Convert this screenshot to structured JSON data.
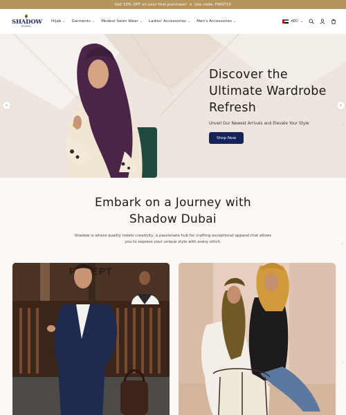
{
  "announcement": {
    "text_before": "Get 10% OFF on your first purchase!",
    "text_after": "Use code: FIRST10"
  },
  "header": {
    "logo": {
      "name": "SHADOW",
      "sub": "DUBAI"
    },
    "nav": [
      {
        "label": "Hijab"
      },
      {
        "label": "Garments"
      },
      {
        "label": "Modest Swim Wear"
      },
      {
        "label": "Ladies' Accessories"
      },
      {
        "label": "Men's Accessories"
      }
    ],
    "currency": "AED",
    "icons": [
      "uae-flag-icon",
      "chevron-down-icon",
      "search-icon",
      "account-icon",
      "cart-icon"
    ]
  },
  "hero": {
    "title_line1": "Discover the",
    "title_line2": "Ultimate Wardrobe",
    "title_line3": "Refresh",
    "subtitle": "Unveil Our Newest Arrivals and Elevate Your Style",
    "button": "Shop Now",
    "button_color": "#16235b"
  },
  "intro": {
    "title_line1": "Embark on a Journey with",
    "title_line2": "Shadow Dubai",
    "text_line1": "Shadow is where quality meets creativity, a passionate hub for crafting exceptional apparel that allows",
    "text_line2": "you to express your unique style with every stitch."
  },
  "tiles": {
    "left": {
      "sign": "RECEPT"
    }
  },
  "colors": {
    "announcement": "#b6955d",
    "brand_navy": "#1e2d6e",
    "hero_bg": "#efe7df"
  }
}
